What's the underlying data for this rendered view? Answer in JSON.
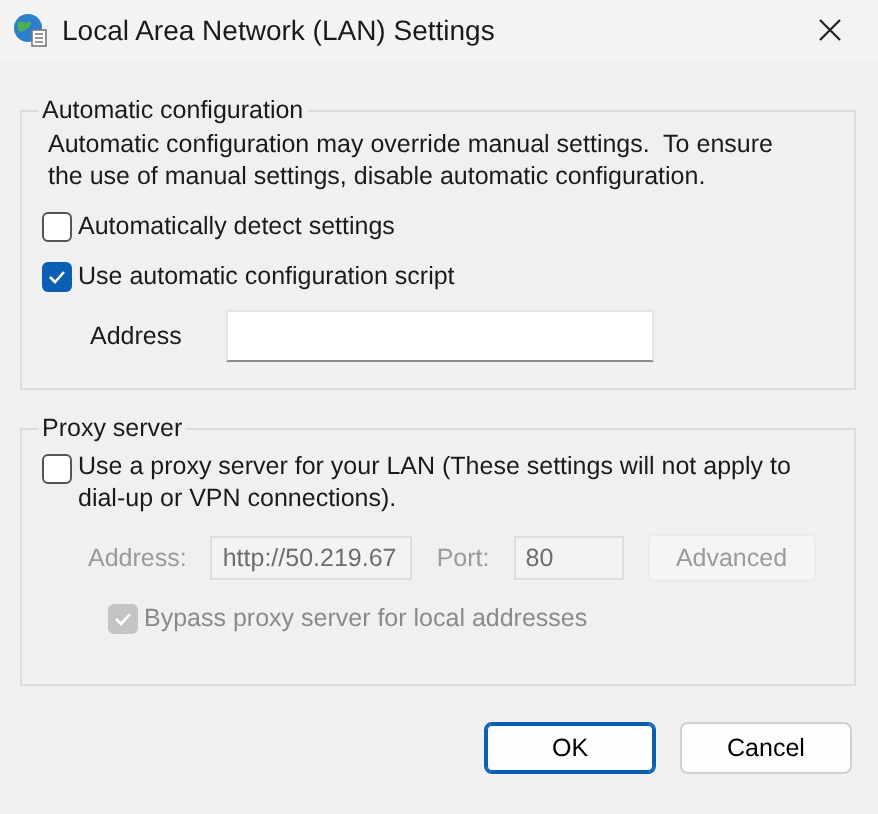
{
  "window": {
    "title": "Local Area Network (LAN) Settings"
  },
  "automatic_configuration": {
    "title": "Automatic configuration",
    "description": "Automatic configuration may override manual settings.  To ensure the use of manual settings, disable automatic configuration.",
    "options": [
      {
        "label": "Automatically detect settings",
        "checked": false
      },
      {
        "label": "Use automatic configuration script",
        "checked": true
      }
    ],
    "address": {
      "label": "Address"
    }
  },
  "proxy_server": {
    "title": "Proxy server",
    "use_proxy": {
      "label": "Use a proxy server for your LAN (These settings will not apply to dial-up or VPN connections).",
      "checked": false
    },
    "address": {
      "label": "Address:",
      "value": "http://50.219.67",
      "disabled": true
    },
    "port": {
      "label": "Port:",
      "value": "80",
      "disabled": true
    },
    "advanced_button": {
      "label": "Advanced",
      "disabled": true
    },
    "bypass": {
      "label": "Bypass proxy server for local addresses",
      "checked": true,
      "disabled": true
    }
  },
  "buttons": [
    {
      "label": "OK",
      "kind": "default"
    },
    {
      "label": "Cancel",
      "kind": "normal"
    }
  ]
}
